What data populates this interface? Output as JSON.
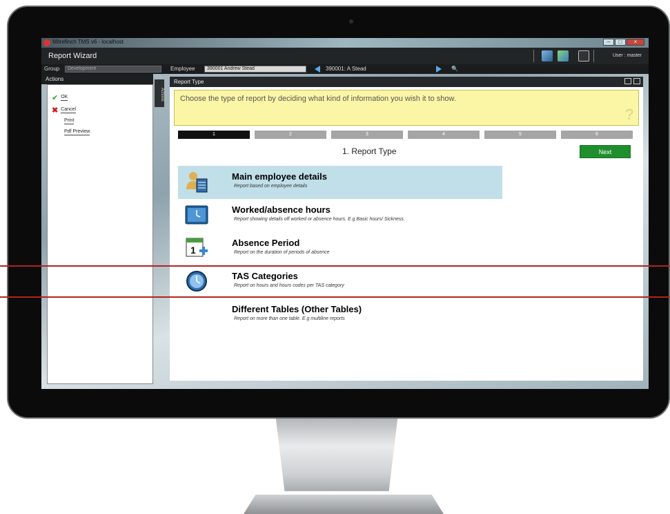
{
  "window": {
    "title": "Mitrefinch TMS v6 - localhost",
    "controls": [
      "–",
      "□",
      "×"
    ]
  },
  "header": {
    "wizard_title": "Report Wizard",
    "user": "User : master"
  },
  "toolbar": {
    "group_label": "Group",
    "group_value": "Development",
    "employee_label": "Employee",
    "employee_value": "390001 Andrew Stead",
    "employee_nav": "390001: A Stead"
  },
  "actions": {
    "heading": "Actions",
    "tab_label": "Actions",
    "items": [
      {
        "label": "OK"
      },
      {
        "label": "Cancel"
      },
      {
        "label": "Print"
      },
      {
        "label": "Pdf Preview"
      }
    ]
  },
  "main": {
    "heading": "Report Type",
    "instruction": "Choose the type of report by deciding what kind of information you wish it to show.",
    "help_icon": "?",
    "steps": [
      {
        "label": "1",
        "active": true
      },
      {
        "label": "2",
        "active": false
      },
      {
        "label": "3",
        "active": false
      },
      {
        "label": "4",
        "active": false
      },
      {
        "label": "5",
        "active": false
      },
      {
        "label": "6",
        "active": false
      }
    ],
    "step_title": "1. Report Type",
    "next_label": "Next",
    "options": [
      {
        "title": "Main employee details",
        "desc": "Report based on employee details",
        "icon": "employee-icon",
        "selected": true
      },
      {
        "title": "Worked/absence hours",
        "desc": "Report showing details off worked or absence hours. E.g Basic hours/ Sickness.",
        "icon": "clock-screen-icon",
        "selected": false
      },
      {
        "title": "Absence Period",
        "desc": "Report on the duration of periods of absence",
        "icon": "calendar-icon",
        "selected": false
      },
      {
        "title": "TAS Categories",
        "desc": "Report on hours and hours codes per TAS category",
        "icon": "clock-icon",
        "selected": false
      },
      {
        "title": "Different Tables (Other Tables)",
        "desc": "Report on more than one table. E.g multiline reports",
        "icon": "",
        "selected": false
      }
    ]
  },
  "colors": {
    "next_button": "#1f8f2e",
    "selected_row": "#c0dfe9",
    "instruction_bg": "#fbf6a6",
    "highlight_lines": "#b3221f"
  }
}
